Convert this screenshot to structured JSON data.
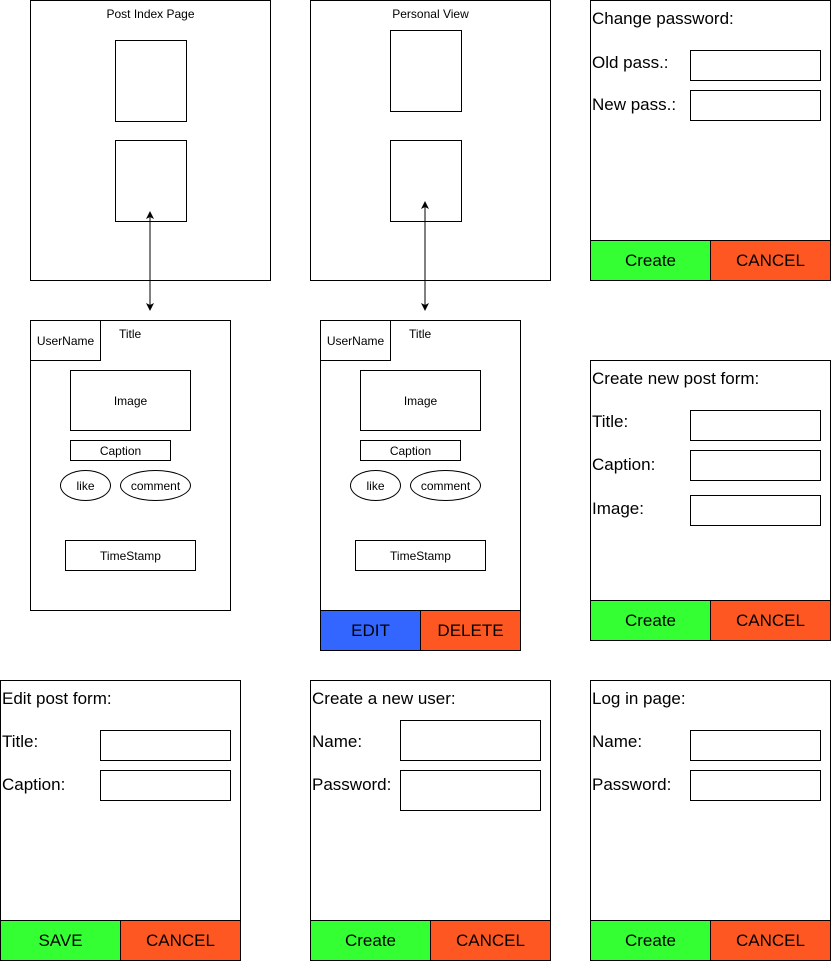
{
  "post_index": {
    "title": "Post Index Page"
  },
  "personal_view": {
    "title": "Personal View"
  },
  "post_card_1": {
    "username": "UserName",
    "title": "Title",
    "image": "Image",
    "caption": "Caption",
    "like": "like",
    "comment": "comment",
    "timestamp": "TimeStamp"
  },
  "post_card_2": {
    "username": "UserName",
    "title": "Title",
    "image": "Image",
    "caption": "Caption",
    "like": "like",
    "comment": "comment",
    "timestamp": "TimeStamp",
    "edit": "EDIT",
    "delete": "DELETE"
  },
  "change_password": {
    "heading": "Change password:",
    "old_label": "Old pass.:",
    "new_label": "New pass.:",
    "create": "Create",
    "cancel": "CANCEL"
  },
  "create_post": {
    "heading": "Create new post form:",
    "title_label": "Title:",
    "caption_label": "Caption:",
    "image_label": "Image:",
    "create": "Create",
    "cancel": "CANCEL"
  },
  "edit_post": {
    "heading": "Edit post form:",
    "title_label": "Title:",
    "caption_label": "Caption:",
    "save": "SAVE",
    "cancel": "CANCEL"
  },
  "create_user": {
    "heading": "Create a new user:",
    "name_label": "Name:",
    "password_label": "Password:",
    "create": "Create",
    "cancel": "CANCEL"
  },
  "login": {
    "heading": "Log in page:",
    "name_label": "Name:",
    "password_label": "Password:",
    "create": "Create",
    "cancel": "CANCEL"
  },
  "colors": {
    "green": "#33ff33",
    "red": "#ff5722",
    "blue": "#3366ff"
  }
}
